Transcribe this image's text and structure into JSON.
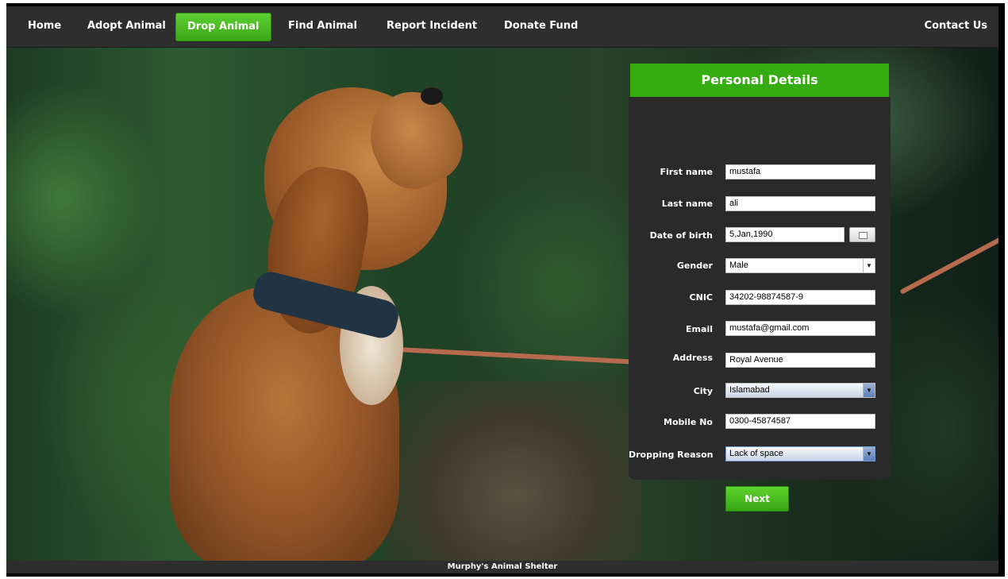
{
  "nav": {
    "items": [
      {
        "label": "Home"
      },
      {
        "label": "Adopt Animal"
      },
      {
        "label": "Drop Animal"
      },
      {
        "label": "Find Animal"
      },
      {
        "label": "Report Incident"
      },
      {
        "label": "Donate Fund"
      }
    ],
    "active_index": 2,
    "contact_label": "Contact Us"
  },
  "form": {
    "title": "Personal Details",
    "fields": {
      "first_name": {
        "label": "First name",
        "value": "mustafa"
      },
      "last_name": {
        "label": "Last name",
        "value": "ali"
      },
      "dob": {
        "label": "Date of birth",
        "value": "5,Jan,1990"
      },
      "gender": {
        "label": "Gender",
        "value": "Male"
      },
      "cnic": {
        "label": "CNIC",
        "value": "34202-98874587-9"
      },
      "email": {
        "label": "Email",
        "value": "mustafa@gmail.com"
      },
      "address": {
        "label": "Address",
        "value": "Royal Avenue"
      },
      "city": {
        "label": "City",
        "value": "Islamabad"
      },
      "mobile": {
        "label": "Mobile No",
        "value": "0300-45874587"
      },
      "reason": {
        "label": "Dropping Reason",
        "value": "Lack of space"
      }
    },
    "next_label": "Next",
    "arrow_glyph": "▼"
  },
  "footer": {
    "text": "Murphy's Animal Shelter"
  },
  "colors": {
    "accent": "#35ac0f",
    "nav_bg": "#2e2e2e",
    "panel_bg": "#2a2a2a"
  }
}
